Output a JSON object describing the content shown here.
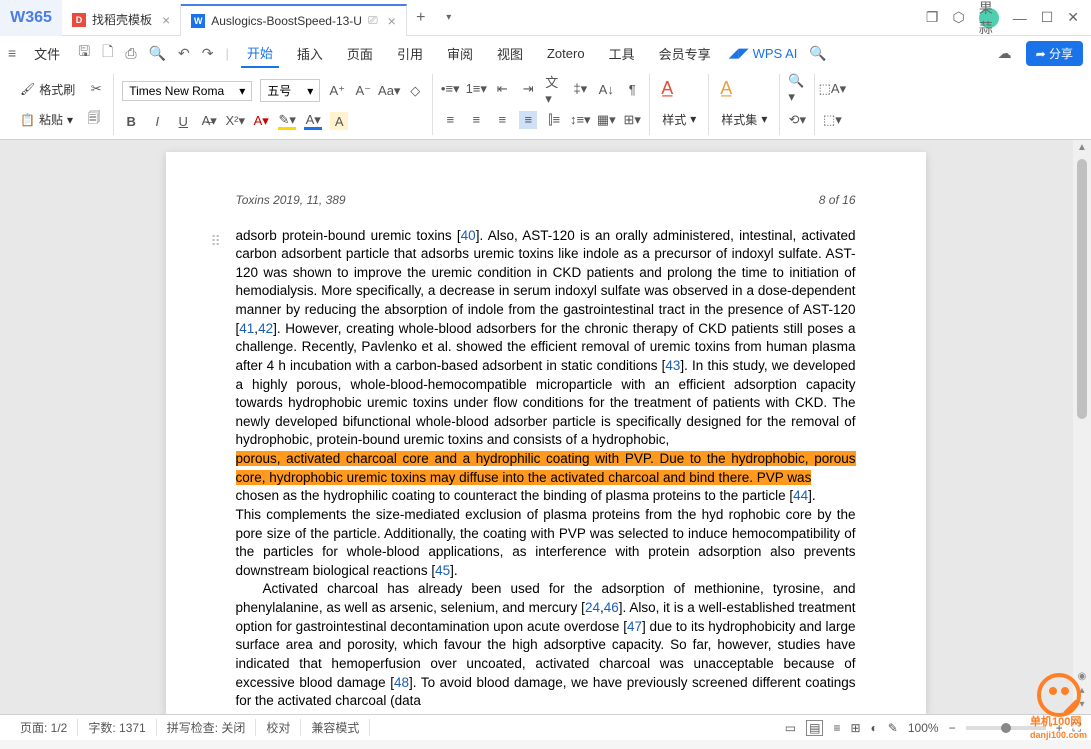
{
  "titlebar": {
    "logo": "W365",
    "tabs": [
      {
        "icon": "D",
        "icon_color": "#e74c3c",
        "label": "找稻壳模板",
        "active": false
      },
      {
        "icon": "W",
        "icon_color": "#1a73e8",
        "label": "Auslogics-BoostSpeed-13-U",
        "active": true
      }
    ],
    "avatar": "果蒜"
  },
  "menubar": {
    "file": "文件",
    "items": [
      "开始",
      "插入",
      "页面",
      "引用",
      "审阅",
      "视图",
      "Zotero",
      "工具",
      "会员专享"
    ],
    "active": "开始",
    "wps_ai": "WPS AI",
    "share": "分享"
  },
  "ribbon": {
    "format_brush": "格式刷",
    "paste": "粘贴",
    "font": "Times New Roma",
    "size": "五号",
    "bold": "B",
    "italic": "I",
    "underline": "U",
    "strike": "A",
    "style": "样式",
    "styleset": "样式集"
  },
  "doc": {
    "header_left": "Toxins 2019, 11, 389",
    "header_right": "8 of 16",
    "p1a": "adsorb protein-bound uremic toxins [",
    "ref40": "40",
    "p1b": "]. Also, AST-120 is an orally administered, intestinal, activated carbon adsorbent particle that adsorbs uremic toxins like indole as a precursor of indoxyl sulfate. AST-120 was shown to improve the uremic condition in CKD patients and prolong the time to initiation of hemodialysis. More specifically, a decrease in serum indoxyl sulfate was observed in a dose-dependent manner by reducing the absorption of indole from the gastrointestinal tract in the presence of AST-120 [",
    "ref41": "41",
    "ref42": "42",
    "p1c": "]. However, creating whole-blood adsorbers for the chronic therapy of CKD patients still poses a challenge. Recently, Pavlenko et al. showed the efficient removal of uremic toxins from human plasma after 4 h incubation with a carbon-based adsorbent in static conditions [",
    "ref43": "43",
    "p1d": "]. In this study, we developed a highly porous, whole-blood-hemocompatible microparticle with an efficient adsorption capacity towards hydrophobic uremic toxins under flow conditions for the treatment of patients with CKD. The newly developed bifunctional whole-blood adsorber particle is specifically designed for the removal of hydrophobic, protein-bound uremic toxins and consists of a hydrophobic,",
    "hl": "porous, activated charcoal core and a hydrophilic coating with PVP. Due to the hydrophobic, porous core, hydrophobic uremic toxins may diffuse into the activated charcoal and bind there. PVP was",
    "p2a": "chosen as the hydrophilic coating to counteract the binding of plasma proteins to the particle [",
    "ref44": "44",
    "p2b": "].",
    "p3a": "This complements the size-mediated exclusion of plasma proteins from the hyd rophobic core by the pore size of the particle. Additionally, the coating with PVP was selected to induce hemocompatibility of the particles for whole-blood applications, as interference with protein adsorption also prevents downstream biological reactions [",
    "ref45": "45",
    "p3b": "].",
    "p4a": "Activated charcoal has already been used for the adsorption of methionine, tyrosine, and phenylalanine, as well as arsenic, selenium, and mercury [",
    "ref24": "24",
    "ref46": "46",
    "p4b": "]. Also, it is a well-established treatment option for gastrointestinal decontamination upon acute overdose [",
    "ref47": "47",
    "p4c": "] due to its hydrophobicity and large surface area and porosity, which favour the high adsorptive capacity. So far, however, studies have indicated that hemoperfusion over uncoated, activated charcoal was unacceptable because of excessive blood damage [",
    "ref48": "48",
    "p4d": "]. To avoid blood damage, we have previously screened different coatings for the activated charcoal (data"
  },
  "statusbar": {
    "page": "页面: 1/2",
    "words": "字数: 1371",
    "spell": "拼写检查: 关闭",
    "proof": "校对",
    "compat": "兼容模式",
    "zoom": "100%"
  },
  "watermark": "单机100网",
  "watermark_url": "danji100.com"
}
